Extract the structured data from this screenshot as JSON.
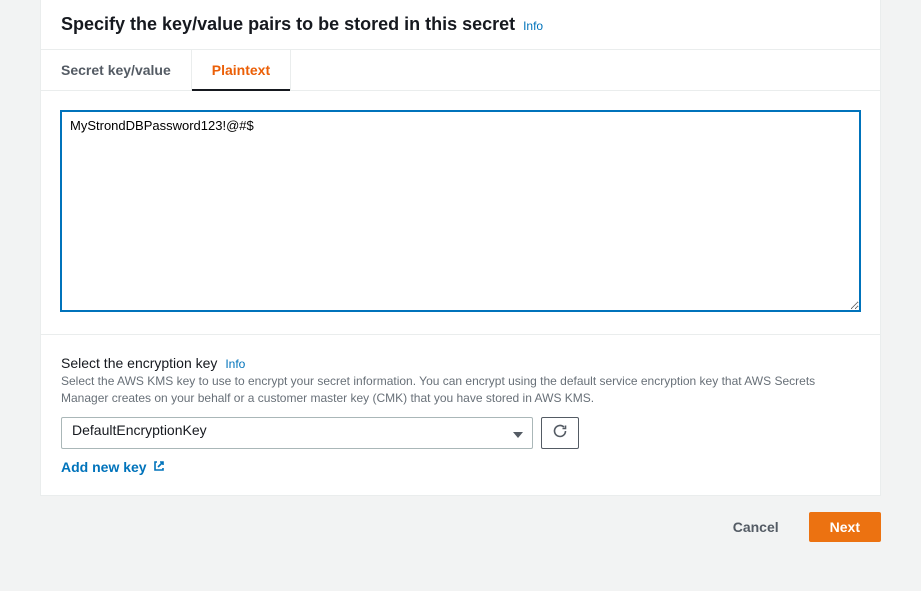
{
  "panel": {
    "title": "Specify the key/value pairs to be stored in this secret",
    "info": "Info"
  },
  "tabs": {
    "keyvalue": "Secret key/value",
    "plaintext": "Plaintext"
  },
  "plaintext_value": "MyStrondDBPassword123!@#$",
  "encryption": {
    "label": "Select the encryption key",
    "info": "Info",
    "help": "Select the AWS KMS key to use to encrypt your secret information. You can encrypt using the default service encryption key that AWS Secrets Manager creates on your behalf or a customer master key (CMK) that you have stored in AWS KMS.",
    "selected": "DefaultEncryptionKey",
    "add_new": "Add new key"
  },
  "actions": {
    "cancel": "Cancel",
    "next": "Next"
  }
}
